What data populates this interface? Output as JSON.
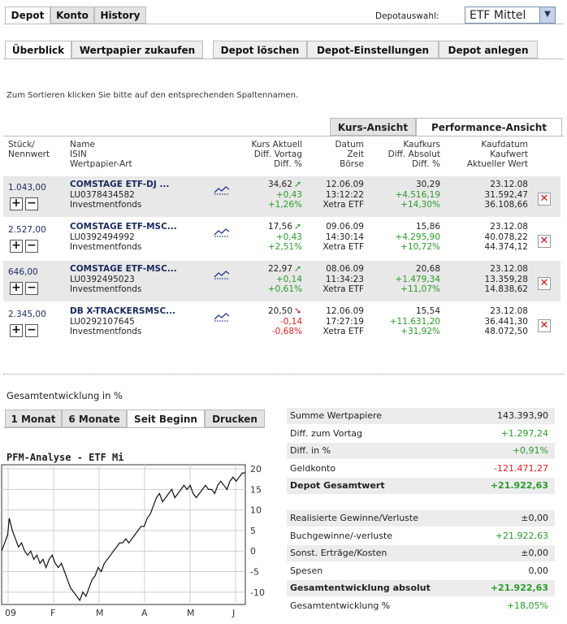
{
  "main_tabs": [
    "Depot",
    "Konto",
    "History"
  ],
  "depot_select": {
    "label": "Depotauswahl:",
    "value": "ETF Mittel"
  },
  "sub_tabs": [
    "Überblick",
    "Wertpapier zukaufen",
    "Depot löschen",
    "Depot-Einstellungen",
    "Depot anlegen"
  ],
  "sort_hint": "Zum Sortieren klicken Sie bitte auf den entsprechenden Spaltennamen.",
  "view_tabs": [
    "Kurs-Ansicht",
    "Performance-Ansicht"
  ],
  "columns": {
    "c1": [
      "Stück/",
      "Nennwert"
    ],
    "c2": [
      "Name",
      "ISIN",
      "Wertpapier-Art"
    ],
    "c3": [
      "Kurs Aktuell",
      "Diff. Vortag",
      "Diff. %"
    ],
    "c4": [
      "Datum",
      "Zeit",
      "Börse"
    ],
    "c5": [
      "Kaufkurs",
      "Diff. Absolut",
      "Diff. %"
    ],
    "c6": [
      "Kaufdatum",
      "Kaufwert",
      "Aktueller Wert"
    ]
  },
  "rows": [
    {
      "qty": "1.043,00",
      "name": "COMSTAGE ETF-DJ ...",
      "isin": "LU0378434582",
      "type": "Investmentfonds",
      "price": "34,62",
      "diff": "+0,43",
      "diffpct": "+1,26%",
      "date": "12.06.09",
      "time": "13:12:22",
      "exchange": "Xetra ETF",
      "buyprice": "30,29",
      "absdiff": "+4.516,19",
      "abspct": "+14,30%",
      "buydate": "23.12.08",
      "buyvalue": "31.592,47",
      "curvalue": "36.108,66",
      "trend": "up"
    },
    {
      "qty": "2.527,00",
      "name": "COMSTAGE ETF-MSC...",
      "isin": "LU0392494992",
      "type": "Investmentfonds",
      "price": "17,56",
      "diff": "+0,43",
      "diffpct": "+2,51%",
      "date": "09.06.09",
      "time": "14:30:14",
      "exchange": "Xetra ETF",
      "buyprice": "15,86",
      "absdiff": "+4.295,90",
      "abspct": "+10,72%",
      "buydate": "23.12.08",
      "buyvalue": "40.078,22",
      "curvalue": "44.374,12",
      "trend": "up"
    },
    {
      "qty": "646,00",
      "name": "COMSTAGE ETF-MSC...",
      "isin": "LU0392495023",
      "type": "Investmentfonds",
      "price": "22,97",
      "diff": "+0,14",
      "diffpct": "+0,61%",
      "date": "08.06.09",
      "time": "11:34:23",
      "exchange": "Xetra ETF",
      "buyprice": "20,68",
      "absdiff": "+1.479,34",
      "abspct": "+11,07%",
      "buydate": "23.12.08",
      "buyvalue": "13.359,28",
      "curvalue": "14.838,62",
      "trend": "up"
    },
    {
      "qty": "2.345,00",
      "name": "DB X-TRACKERSMSC...",
      "isin": "LU0292107645",
      "type": "Investmentfonds",
      "price": "20,50",
      "diff": "-0,14",
      "diffpct": "-0,68%",
      "date": "12.06.09",
      "time": "17:27:19",
      "exchange": "Xetra ETF",
      "buyprice": "15,54",
      "absdiff": "+11.631,20",
      "abspct": "+31,92%",
      "buydate": "23.12.08",
      "buyvalue": "36.441,30",
      "curvalue": "48.072,50",
      "trend": "down"
    }
  ],
  "perf_title": "Gesamtentwicklung in %",
  "period_tabs": [
    "1 Monat",
    "6 Monate",
    "Seit Beginn",
    "Drucken"
  ],
  "chart_data": {
    "type": "line",
    "title": "PFM-Analyse - ETF Mi",
    "x_ticks": [
      "09",
      "F",
      "M",
      "A",
      "M",
      "J"
    ],
    "y_ticks": [
      20,
      15,
      10,
      5,
      0,
      -5,
      -10
    ],
    "ylim": [
      -13,
      21
    ],
    "grid": true,
    "x": [
      0,
      2,
      4,
      5,
      7,
      9,
      11,
      13,
      15,
      17,
      19,
      21,
      23,
      25,
      27,
      29,
      31,
      33,
      35,
      37,
      39,
      41,
      43,
      45,
      47,
      49,
      51,
      53,
      55,
      57,
      59,
      61,
      63,
      65,
      67,
      69,
      71,
      73,
      75,
      77,
      79,
      81,
      83,
      85,
      87,
      89,
      91,
      93,
      95,
      97,
      99,
      101,
      103,
      105,
      107,
      109,
      111,
      113,
      115,
      117,
      119,
      121,
      123,
      125,
      127,
      129,
      131,
      133,
      135,
      137,
      139,
      141,
      143,
      145,
      147,
      149,
      151,
      153,
      155,
      157,
      159
    ],
    "values": [
      0,
      2,
      4,
      8,
      5,
      3,
      1,
      2,
      0,
      -1,
      0,
      -2,
      -1,
      -3,
      -2,
      -4,
      -2,
      -1,
      -3,
      -4,
      -3,
      -5,
      -7,
      -9,
      -10,
      -11,
      -12,
      -10,
      -11,
      -9,
      -7,
      -6,
      -4,
      -5,
      -3,
      -2,
      -1,
      0,
      1,
      2,
      2,
      3,
      2,
      3,
      4,
      5,
      6,
      6,
      8,
      9,
      11,
      13,
      14,
      12,
      13,
      14,
      15,
      13,
      14,
      15,
      16,
      15,
      16,
      14,
      13,
      14,
      15,
      16,
      15,
      15,
      14,
      16,
      17,
      16,
      15,
      17,
      18,
      17,
      18,
      19,
      19
    ]
  },
  "summary_top": [
    {
      "label": "Summe Wertpapiere",
      "value": "143.393,90",
      "tone": "normal"
    },
    {
      "label": "Diff. zum Vortag",
      "value": "+1.297,24",
      "tone": "green"
    },
    {
      "label": "Diff. in %",
      "value": "+0,91%",
      "tone": "green"
    },
    {
      "label": "Geldkonto",
      "value": "-121.471,27",
      "tone": "red"
    },
    {
      "label": "Depot Gesamtwert",
      "value": "+21.922,63",
      "tone": "green-bold"
    }
  ],
  "summary_bottom": [
    {
      "label": "Realisierte Gewinne/Verluste",
      "value": "±0,00",
      "tone": "normal"
    },
    {
      "label": "Buchgewinne/-verluste",
      "value": "+21.922,63",
      "tone": "green"
    },
    {
      "label": "Sonst. Erträge/Kosten",
      "value": "±0,00",
      "tone": "normal"
    },
    {
      "label": "Spesen",
      "value": "0,00",
      "tone": "normal"
    },
    {
      "label": "Gesamtentwicklung absolut",
      "value": "+21.922,63",
      "tone": "green-bold"
    },
    {
      "label": "Gesamtentwicklung %",
      "value": "+18,05%",
      "tone": "green"
    }
  ]
}
